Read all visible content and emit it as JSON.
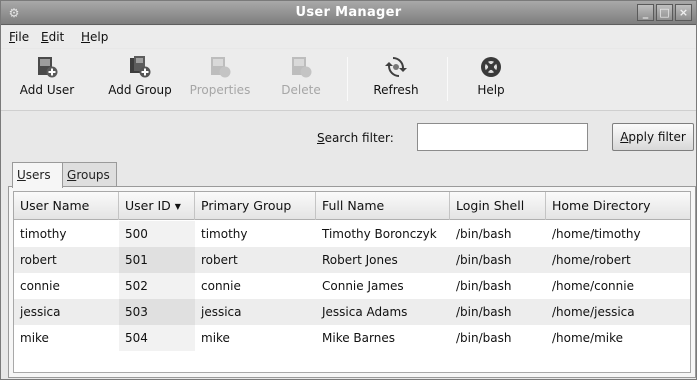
{
  "window": {
    "title": "User Manager",
    "controls": {
      "minimize": "_",
      "maximize": "□",
      "close": "×"
    }
  },
  "menubar": {
    "items": [
      {
        "label_u": "F",
        "label_rest": "ile"
      },
      {
        "label_u": "E",
        "label_rest": "dit"
      },
      {
        "label_u": "H",
        "label_rest": "elp"
      }
    ]
  },
  "toolbar": {
    "buttons": [
      {
        "label": "Add User",
        "icon": "add-user-icon",
        "enabled": true
      },
      {
        "label": "Add Group",
        "icon": "add-group-icon",
        "enabled": true
      },
      {
        "label": "Properties",
        "icon": "properties-icon",
        "enabled": false
      },
      {
        "label": "Delete",
        "icon": "delete-icon",
        "enabled": false
      },
      {
        "label": "Refresh",
        "icon": "refresh-icon",
        "enabled": true
      },
      {
        "label": "Help",
        "icon": "help-icon",
        "enabled": true
      }
    ]
  },
  "search": {
    "label_u": "S",
    "label_rest": "earch filter:",
    "value": "",
    "placeholder": ""
  },
  "apply_button": {
    "label_u": "A",
    "label_rest": "pply filter"
  },
  "tabs": [
    {
      "label_pre": "",
      "label_u": "U",
      "label_rest": "sers",
      "active": true
    },
    {
      "label_pre": "",
      "label_u": "G",
      "label_rest": "roups",
      "active": false
    }
  ],
  "table": {
    "columns": [
      "User Name",
      "User ID",
      "Primary Group",
      "Full Name",
      "Login Shell",
      "Home Directory"
    ],
    "sort_column": "User ID",
    "sort_indicator": "▼",
    "rows": [
      [
        "timothy",
        "500",
        "timothy",
        "Timothy Boronczyk",
        "/bin/bash",
        "/home/timothy"
      ],
      [
        "robert",
        "501",
        "robert",
        "Robert Jones",
        "/bin/bash",
        "/home/robert"
      ],
      [
        "connie",
        "502",
        "connie",
        "Connie James",
        "/bin/bash",
        "/home/connie"
      ],
      [
        "jessica",
        "503",
        "jessica",
        "Jessica Adams",
        "/bin/bash",
        "/home/jessica"
      ],
      [
        "mike",
        "504",
        "mike",
        "Mike Barnes",
        "/bin/bash",
        "/home/mike"
      ]
    ]
  }
}
